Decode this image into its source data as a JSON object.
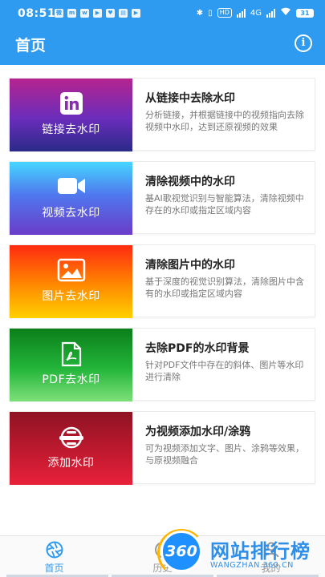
{
  "status_bar": {
    "time": "08:51",
    "notification_icons": [
      "微",
      "m",
      "w",
      "▶",
      "♥",
      "▤",
      "▶"
    ],
    "network_labels": [
      "HD",
      "4G"
    ],
    "battery": "31"
  },
  "header": {
    "title": "首页",
    "info_icon": "info-circle-icon"
  },
  "cards": [
    {
      "thumb_label": "链接去水印",
      "icon": "linkedin-icon",
      "title": "从链接中去除水印",
      "description": "分析链接，并根据链接中的视频指向去除视频中水印，达到还原视频的效果"
    },
    {
      "thumb_label": "视频去水印",
      "icon": "video-camera-icon",
      "title": "清除视频中的水印",
      "description": "基AI歌视觉识别与智能算法，清除视频中存在的水印或指定区域内容"
    },
    {
      "thumb_label": "图片去水印",
      "icon": "image-icon",
      "title": "清除图片中的水印",
      "description": "基于深度的视觉识别算法，清除图片中含有的水印或指定区域内容"
    },
    {
      "thumb_label": "PDF去水印",
      "icon": "pdf-file-icon",
      "title": "去除PDF的水印背景",
      "description": "针对PDF文件中存在的斜体、图片等水印进行清除"
    },
    {
      "thumb_label": "添加水印",
      "icon": "brush-ring-icon",
      "title": "为视频添加水印/涂鸦",
      "description": "可为视频添加文字、图片、涂鸦等效果，与原视频融合"
    }
  ],
  "bottom_nav": {
    "tabs": [
      {
        "label": "首页",
        "icon": "aperture-icon",
        "active": true
      },
      {
        "label": "历史",
        "icon": "history-icon",
        "active": false
      },
      {
        "label": "我的",
        "icon": "user-icon",
        "active": false
      }
    ]
  },
  "watermark": {
    "badge": "360",
    "brand": "网站排行榜",
    "url": "WANGZHAN.360.CN"
  },
  "colors": {
    "primary": "#2e9bf0",
    "card_title": "#222222",
    "card_desc": "#777777"
  }
}
